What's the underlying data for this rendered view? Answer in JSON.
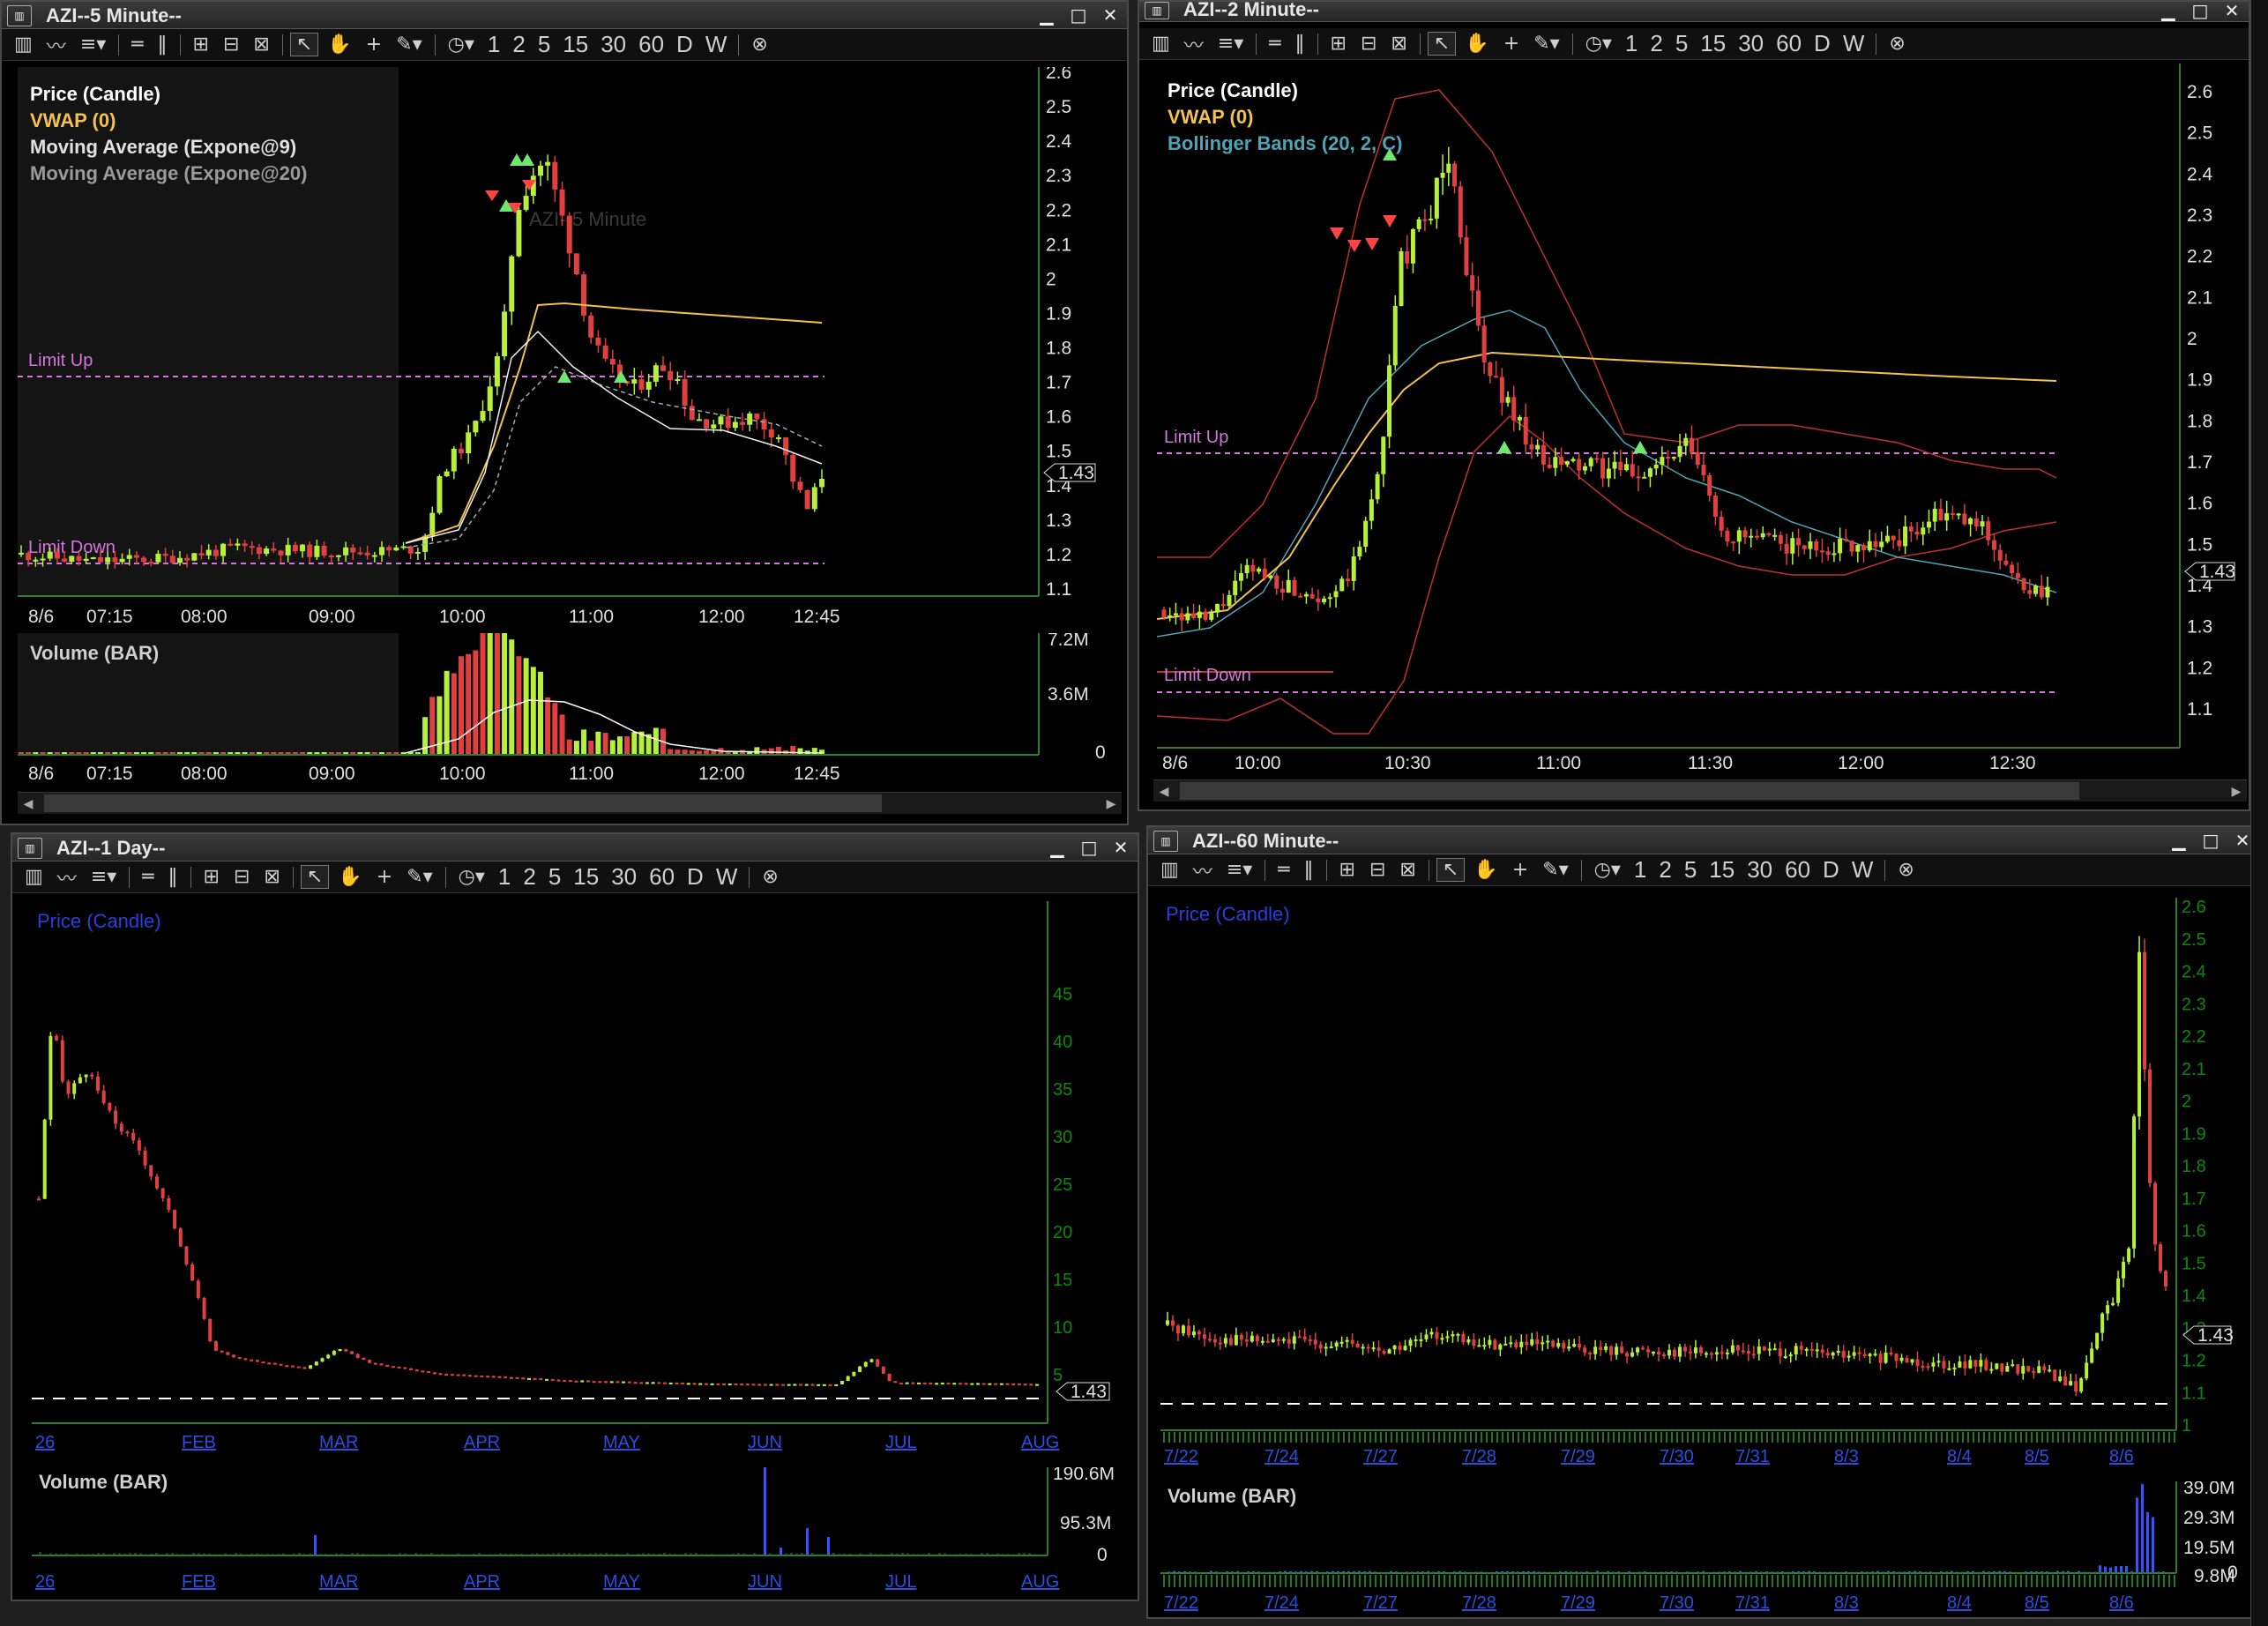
{
  "toolbar": {
    "tools": [
      "chart-type-icon",
      "line-icon",
      "indicator-icon",
      "horizontal-line-icon",
      "vertical-line-icon",
      "zoom-in-icon",
      "zoom-out-icon",
      "zoom-fit-icon",
      "pointer-icon",
      "hand-icon",
      "crosshair-icon",
      "draw-icon",
      "clock-icon"
    ],
    "intervals": [
      "1",
      "2",
      "5",
      "15",
      "30",
      "60",
      "D",
      "W"
    ]
  },
  "windows": {
    "w5": {
      "title": "AZI--5 Minute--",
      "legend": [
        {
          "text": "Price (Candle)",
          "color": "#ffffff"
        },
        {
          "text": "VWAP (0)",
          "color": "#f2c14e"
        },
        {
          "text": "Moving Average (Expone@9)",
          "color": "#e0e0e0"
        },
        {
          "text": "Moving Average (Expone@20)",
          "color": "#9a9a9a"
        }
      ],
      "watermark": "AZI--5 Minute",
      "limit_up": "Limit Up",
      "limit_down": "Limit Down",
      "price_tag": "1.43",
      "yticks": [
        "2.6",
        "2.5",
        "2.4",
        "2.3",
        "2.2",
        "2.1",
        "2",
        "1.9",
        "1.8",
        "1.7",
        "1.6",
        "1.5",
        "1.4",
        "1.3",
        "1.2",
        "1.1"
      ],
      "xticks": [
        "8/6",
        "07:15",
        "08:00",
        "09:00",
        "10:00",
        "11:00",
        "12:00",
        "12:45"
      ],
      "volume_label": "Volume (BAR)",
      "vol_ticks": [
        "7.2M",
        "3.6M",
        "0"
      ]
    },
    "w2": {
      "title": "AZI--2 Minute--",
      "legend": [
        {
          "text": "Price (Candle)",
          "color": "#ffffff"
        },
        {
          "text": "VWAP (0)",
          "color": "#f2c14e"
        },
        {
          "text": "Bollinger Bands (20, 2, C)",
          "color": "#4fa3b5"
        }
      ],
      "limit_up": "Limit Up",
      "limit_down": "Limit Down",
      "price_tag": "1.43",
      "yticks": [
        "2.6",
        "2.5",
        "2.4",
        "2.3",
        "2.2",
        "2.1",
        "2",
        "1.9",
        "1.8",
        "1.7",
        "1.6",
        "1.5",
        "1.4",
        "1.3",
        "1.2",
        "1.1"
      ],
      "xticks": [
        "8/6",
        "10:00",
        "10:30",
        "11:00",
        "11:30",
        "12:00",
        "12:30"
      ]
    },
    "w1d": {
      "title": "AZI--1 Day--",
      "legend": [
        {
          "text": "Price (Candle)",
          "color": "#2a3fe0"
        }
      ],
      "price_tag": "1.43",
      "yticks": [
        "45",
        "40",
        "35",
        "30",
        "25",
        "20",
        "15",
        "10",
        "5"
      ],
      "xticks": [
        "26",
        "FEB",
        "MAR",
        "APR",
        "MAY",
        "JUN",
        "JUL",
        "AUG"
      ],
      "volume_label": "Volume (BAR)",
      "vol_ticks": [
        "190.6M",
        "95.3M",
        "0"
      ]
    },
    "w60": {
      "title": "AZI--60 Minute--",
      "legend": [
        {
          "text": "Price (Candle)",
          "color": "#2a3fe0"
        }
      ],
      "price_tag": "1.43",
      "yticks": [
        "2.6",
        "2.5",
        "2.4",
        "2.3",
        "2.2",
        "2.1",
        "2",
        "1.9",
        "1.8",
        "1.7",
        "1.6",
        "1.5",
        "1.4",
        "1.3",
        "1.2",
        "1.1",
        "1"
      ],
      "xticks": [
        "7/22",
        "7/24",
        "7/27",
        "7/28",
        "7/29",
        "7/30",
        "7/31",
        "8/3",
        "8/4",
        "8/5",
        "8/6"
      ],
      "volume_label": "Volume (BAR)",
      "vol_ticks": [
        "39.0M",
        "29.3M",
        "19.5M",
        "9.8M",
        "0"
      ]
    }
  },
  "chart_data": [
    {
      "type": "candlestick",
      "title": "AZI--5 Minute--",
      "ylim": [
        1.1,
        2.6
      ],
      "price_path": [
        [
          0,
          1.2
        ],
        [
          10,
          1.18
        ],
        [
          20,
          1.19
        ],
        [
          30,
          1.22
        ],
        [
          40,
          1.21
        ],
        [
          50,
          1.21
        ],
        [
          55,
          1.22
        ],
        [
          58,
          1.45
        ],
        [
          62,
          1.55
        ],
        [
          66,
          1.8
        ],
        [
          68,
          2.2
        ],
        [
          70,
          2.3
        ],
        [
          72,
          2.35
        ],
        [
          74,
          2.2
        ],
        [
          76,
          2.05
        ],
        [
          78,
          1.85
        ],
        [
          80,
          1.75
        ],
        [
          84,
          1.68
        ],
        [
          88,
          1.75
        ],
        [
          90,
          1.72
        ],
        [
          92,
          1.6
        ],
        [
          96,
          1.58
        ],
        [
          100,
          1.6
        ],
        [
          104,
          1.55
        ],
        [
          106,
          1.42
        ],
        [
          108,
          1.33
        ],
        [
          110,
          1.43
        ]
      ],
      "vwap": [
        [
          56,
          1.22
        ],
        [
          62,
          1.5
        ],
        [
          68,
          1.9
        ],
        [
          72,
          1.95
        ],
        [
          110,
          1.88
        ]
      ],
      "limit_up": 1.72,
      "limit_down": 1.15,
      "last": 1.43
    },
    {
      "type": "candlestick",
      "title": "AZI--2 Minute--",
      "ylim": [
        1.1,
        2.6
      ],
      "limit_up": 1.72,
      "limit_down": 1.15,
      "last": 1.43
    },
    {
      "type": "candlestick",
      "title": "AZI--1 Day--",
      "ylim": [
        0,
        45
      ],
      "last": 1.43
    },
    {
      "type": "candlestick",
      "title": "AZI--60 Minute--",
      "ylim": [
        1,
        2.6
      ],
      "last": 1.43
    }
  ]
}
